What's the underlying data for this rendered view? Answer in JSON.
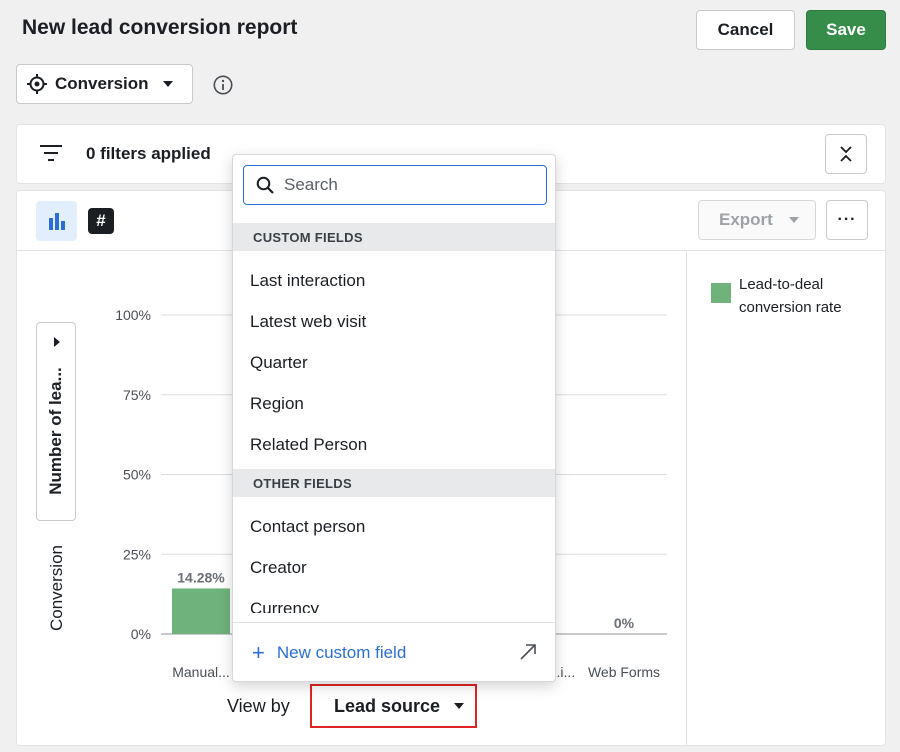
{
  "header": {
    "title": "New lead conversion report",
    "cancel_label": "Cancel",
    "save_label": "Save"
  },
  "mode": {
    "label": "Conversion"
  },
  "filters": {
    "text": "0 filters applied"
  },
  "toolbar": {
    "number_icon": "#",
    "export_label": "Export",
    "more_label": "···"
  },
  "legend": {
    "label": "Lead-to-deal conversion rate",
    "color": "#6fb27b"
  },
  "y_axis": {
    "selector_label": "Number of lea...",
    "mode_label": "Conversion"
  },
  "view_by": {
    "label": "View by",
    "value": "Lead source"
  },
  "chart_data": {
    "type": "bar",
    "categories": [
      "Manual...",
      "...i...",
      "Web Forms"
    ],
    "series": [
      {
        "name": "Lead-to-deal conversion rate",
        "values": [
          14.28,
          null,
          0
        ]
      }
    ],
    "data_labels": [
      "14.28%",
      "",
      "0%"
    ],
    "y_ticks": [
      "100%",
      "75%",
      "50%",
      "25%",
      "0%"
    ],
    "ylim": [
      0,
      100
    ],
    "grid": true
  },
  "dropdown": {
    "search_placeholder": "Search",
    "custom_header": "CUSTOM FIELDS",
    "custom_items": [
      "Last interaction",
      "Latest web visit",
      "Quarter",
      "Region",
      "Related Person"
    ],
    "other_header": "OTHER FIELDS",
    "other_items": [
      "Contact person",
      "Creator",
      "Currency"
    ],
    "footer_label": "New custom field"
  },
  "colors": {
    "accent": "#2b6fd6",
    "save": "#368d4a",
    "highlight": "#e02424"
  }
}
